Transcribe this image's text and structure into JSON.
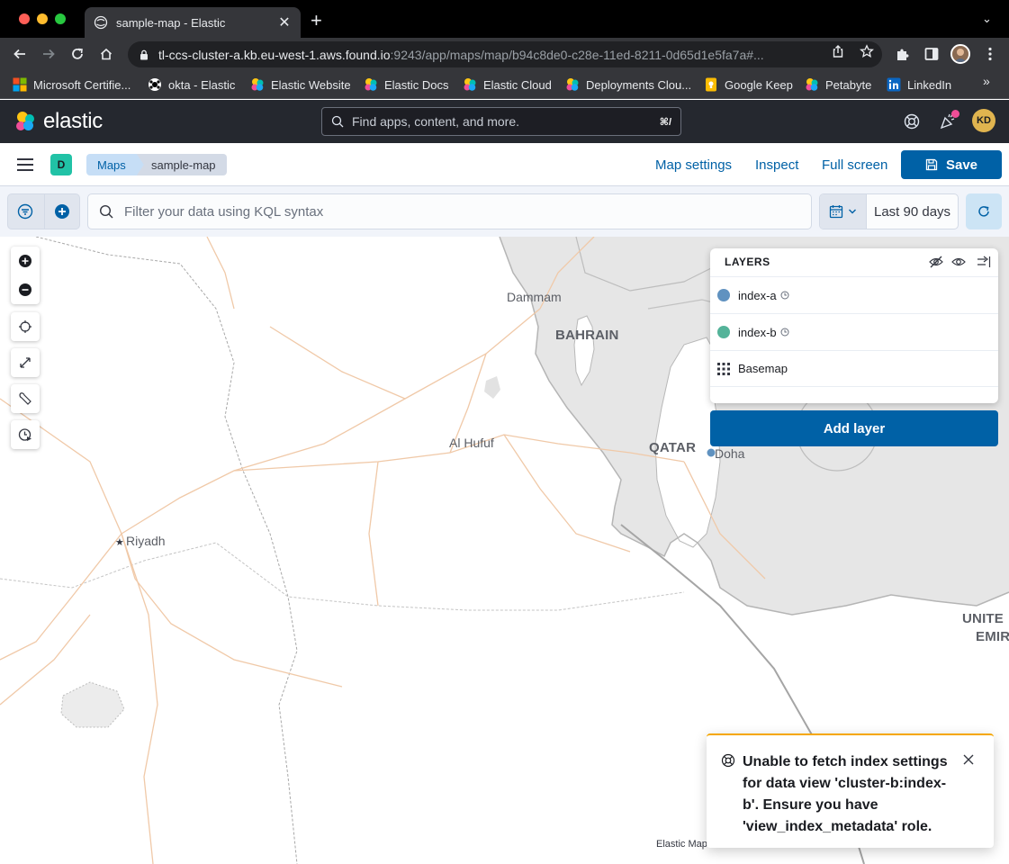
{
  "browser": {
    "tab_title": "sample-map - Elastic",
    "url_host": "tl-ccs-cluster-a.kb.eu-west-1.aws.found.io",
    "url_rest": ":9243/app/maps/map/b94c8de0-c28e-11ed-8211-0d65d1e5fa7a#...",
    "bookmarks": [
      {
        "label": "Microsoft Certifie...",
        "icon": "microsoft-icon"
      },
      {
        "label": "okta - Elastic",
        "icon": "okta-icon"
      },
      {
        "label": "Elastic Website",
        "icon": "elastic-icon"
      },
      {
        "label": "Elastic Docs",
        "icon": "elastic-icon"
      },
      {
        "label": "Elastic Cloud",
        "icon": "elastic-icon"
      },
      {
        "label": "Deployments Clou...",
        "icon": "elastic-icon"
      },
      {
        "label": "Google Keep",
        "icon": "google-keep-icon"
      },
      {
        "label": "Petabyte",
        "icon": "elastic-icon"
      },
      {
        "label": "LinkedIn",
        "icon": "linkedin-icon"
      }
    ],
    "more_bookmarks": "»"
  },
  "kibana": {
    "brand": "elastic",
    "search_placeholder": "Find apps, content, and more.",
    "search_shortcut": "⌘/",
    "user_initials": "KD",
    "space_initial": "D"
  },
  "appbar": {
    "breadcrumbs": [
      "Maps",
      "sample-map"
    ],
    "links": [
      "Map settings",
      "Inspect",
      "Full screen"
    ],
    "save_label": "Save"
  },
  "querybar": {
    "kql_placeholder": "Filter your data using KQL syntax",
    "time_range": "Last 90 days"
  },
  "map": {
    "labels": {
      "dammam": "Dammam",
      "bahrain": "BAHRAIN",
      "al_hufuf": "Al Hufuf",
      "qatar": "QATAR",
      "doha": "Doha",
      "riyadh": "Riyadh",
      "uae_line1": "UNITE",
      "uae_line2": "EMIR"
    },
    "attribution": "Elastic Maps"
  },
  "layers": {
    "title": "LAYERS",
    "items": [
      {
        "name": "index-a",
        "color": "#6092c0",
        "type": "documents"
      },
      {
        "name": "index-b",
        "color": "#54b399",
        "type": "documents"
      },
      {
        "name": "Basemap",
        "type": "tiles"
      }
    ],
    "add_label": "Add layer"
  },
  "toast": {
    "message": "Unable to fetch index settings for data view 'cluster-b:index-b'. Ensure you have 'view_index_metadata' role.",
    "accent": "#f5a700"
  }
}
